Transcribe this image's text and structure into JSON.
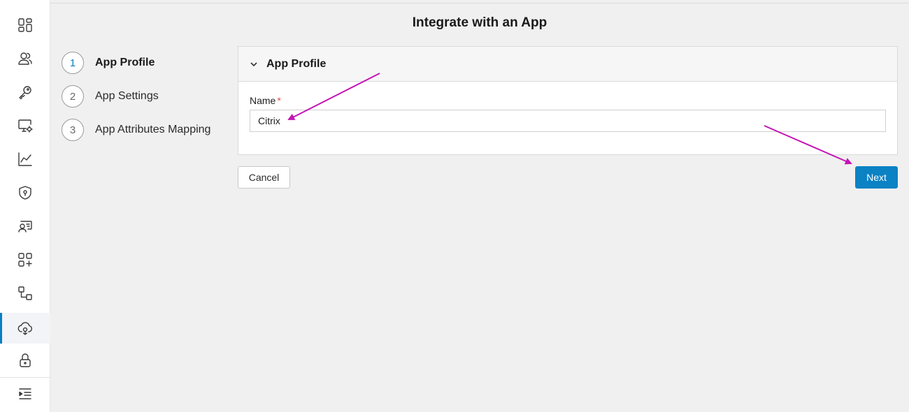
{
  "page": {
    "title": "Integrate with an App"
  },
  "sidebar": {
    "items": [
      {
        "icon": "dashboard-icon"
      },
      {
        "icon": "users-icon"
      },
      {
        "icon": "key-icon"
      },
      {
        "icon": "monitor-settings-icon"
      },
      {
        "icon": "chart-line-icon"
      },
      {
        "icon": "shield-icon"
      },
      {
        "icon": "user-card-icon"
      },
      {
        "icon": "apps-add-icon"
      },
      {
        "icon": "workflow-icon"
      },
      {
        "icon": "cloud-integration-icon",
        "active": true
      },
      {
        "icon": "lock-icon"
      },
      {
        "icon": "collapse-menu-icon"
      }
    ],
    "accent_color": "#0a7ec2"
  },
  "stepper": {
    "steps": [
      {
        "number": "1",
        "label": "App Profile",
        "current": true
      },
      {
        "number": "2",
        "label": "App Settings"
      },
      {
        "number": "3",
        "label": "App Attributes Mapping"
      }
    ]
  },
  "panel": {
    "title": "App Profile",
    "name_field": {
      "label": "Name",
      "required_marker": "*",
      "value": "Citrix"
    }
  },
  "actions": {
    "cancel_label": "Cancel",
    "next_label": "Next",
    "primary_color": "#0a82c4"
  },
  "annotations": {
    "arrow_color": "#c414b4"
  }
}
